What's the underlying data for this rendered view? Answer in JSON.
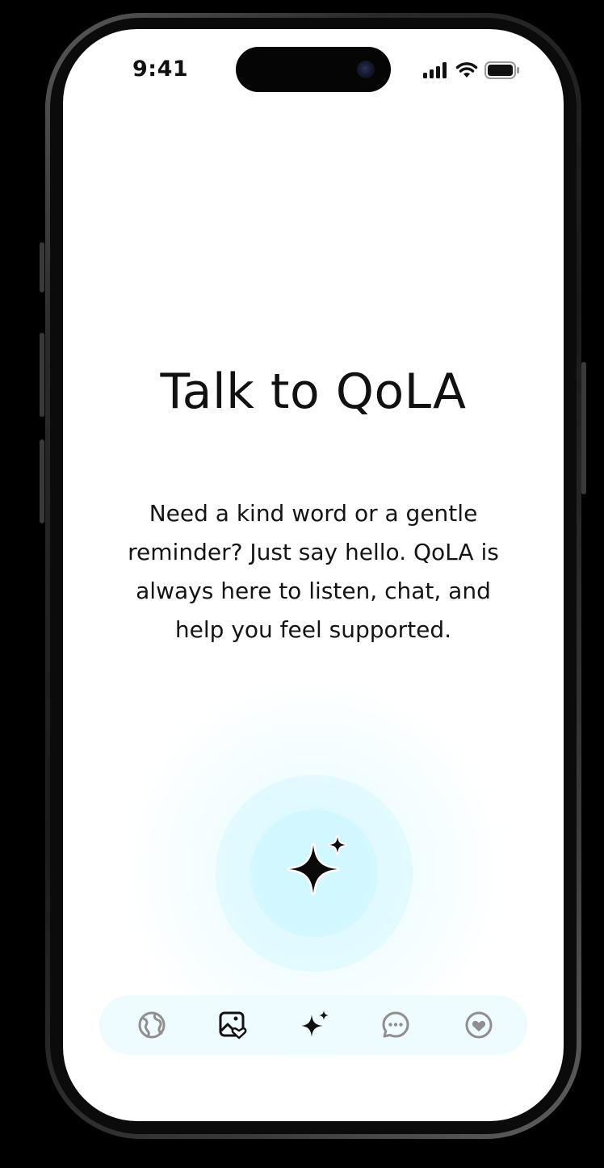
{
  "status_bar": {
    "time": "9:41"
  },
  "main": {
    "title": "Talk to QoLA",
    "description": "Need a kind word or a gentle reminder? Just say hello. QoLA is always here to listen, chat, and help you feel supported."
  },
  "orb": {
    "icon": "sparkle-icon"
  },
  "tab_bar": {
    "tabs": [
      {
        "icon": "globe-icon",
        "active": false
      },
      {
        "icon": "photo-heart-icon",
        "active": false
      },
      {
        "icon": "sparkle-icon",
        "active": true
      },
      {
        "icon": "chat-bubble-icon",
        "active": false
      },
      {
        "icon": "heart-circle-icon",
        "active": false
      }
    ]
  },
  "colors": {
    "accent_glow": "#d7f8ff",
    "tab_bar_bg": "#effcff",
    "text": "#111111",
    "inactive_icon": "#8a8a8a"
  }
}
